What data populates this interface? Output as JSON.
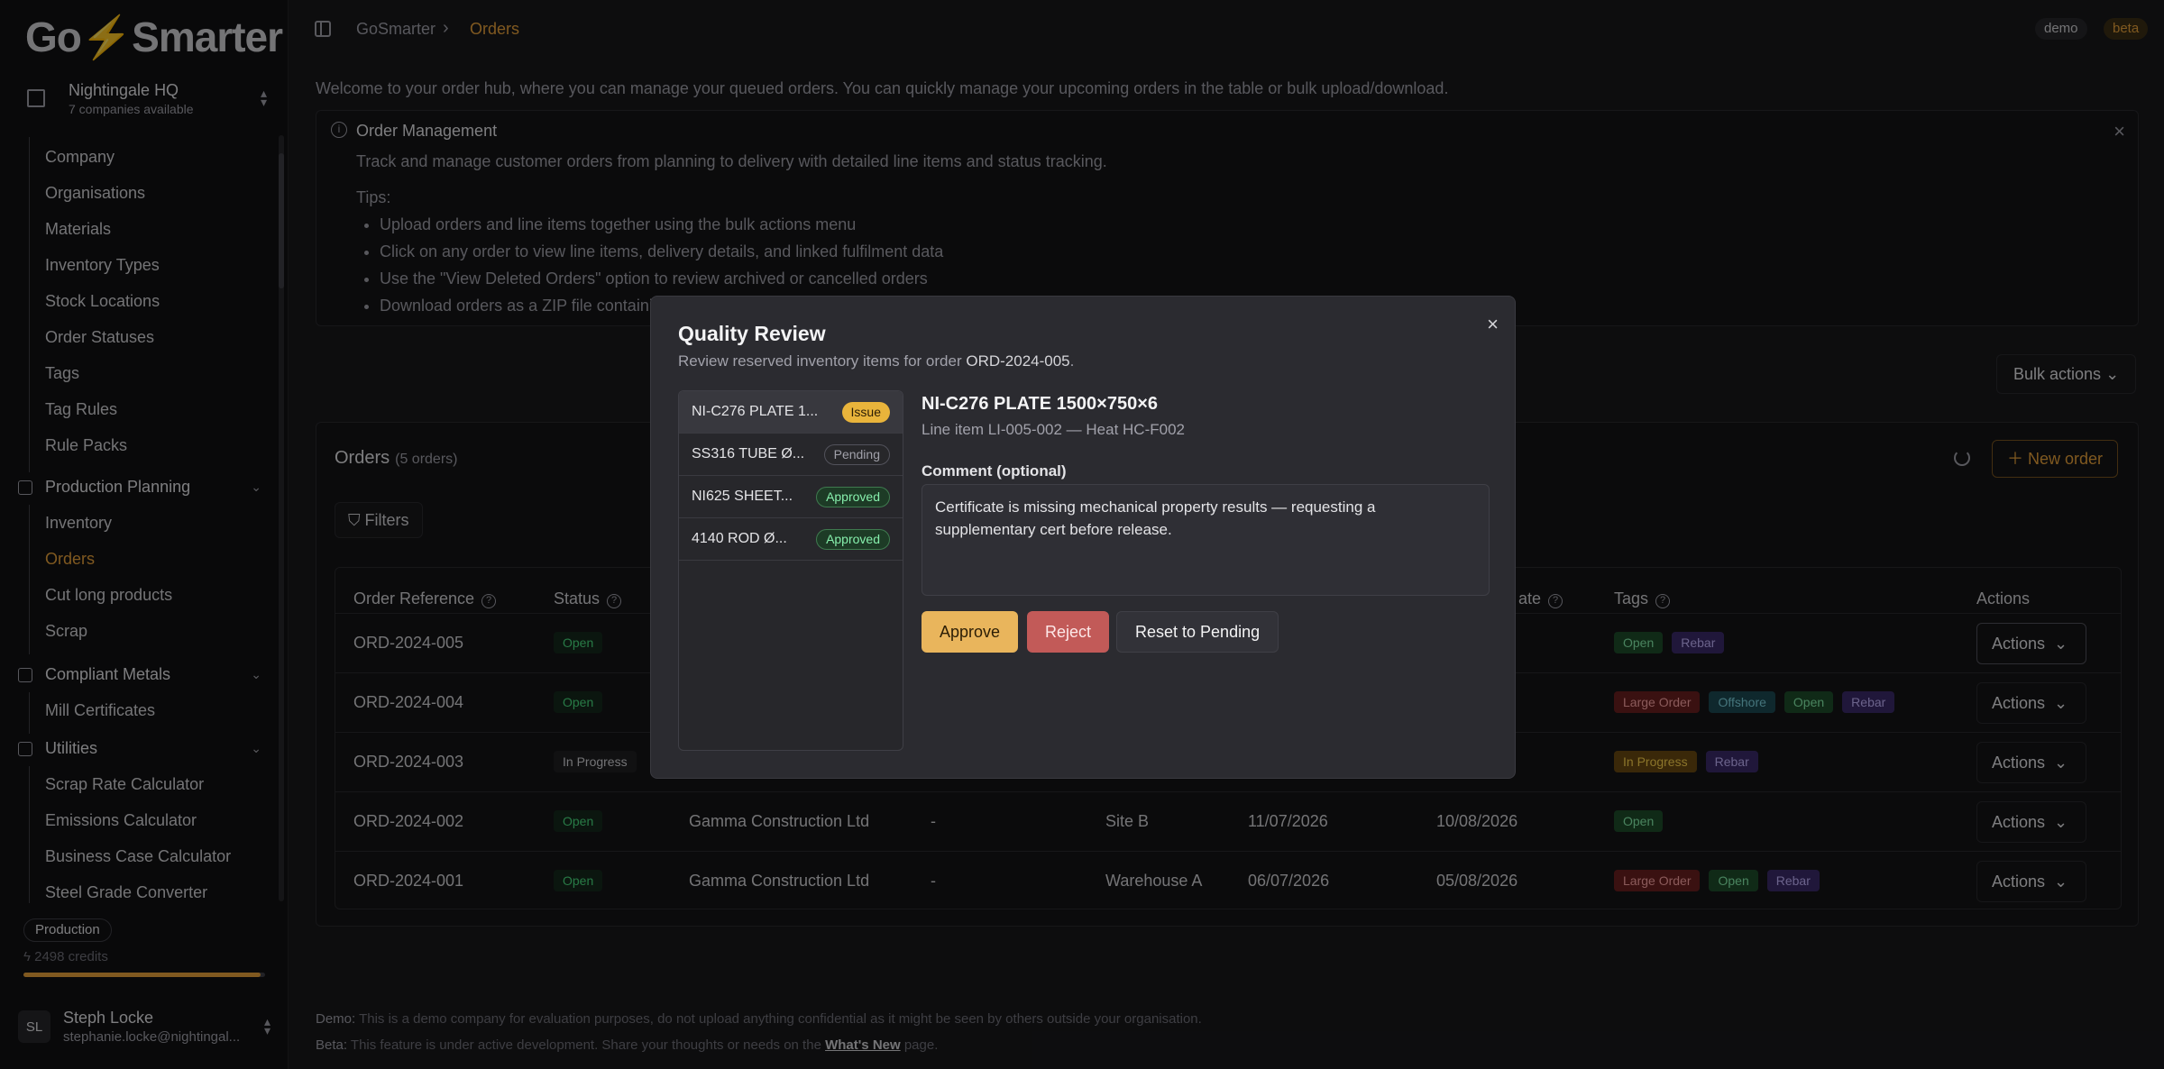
{
  "app": {
    "logo_left": "Go",
    "logo_bolt": "⚡",
    "logo_right": "Smarter"
  },
  "company_switcher": {
    "name": "Nightingale HQ",
    "subtitle": "7 companies available"
  },
  "sidebar": {
    "settings_items": [
      "Company",
      "Organisations",
      "Materials",
      "Inventory Types",
      "Stock Locations",
      "Order Statuses",
      "Tags",
      "Tag Rules",
      "Rule Packs"
    ],
    "production_planning": {
      "label": "Production Planning",
      "items": [
        "Inventory",
        "Orders",
        "Cut long products",
        "Scrap"
      ]
    },
    "compliant_metals": {
      "label": "Compliant Metals",
      "items": [
        "Mill Certificates"
      ]
    },
    "utilities": {
      "label": "Utilities",
      "items": [
        "Scrap Rate Calculator",
        "Emissions Calculator",
        "Business Case Calculator",
        "Steel Grade Converter"
      ]
    },
    "plan_badge": "Production",
    "credits": "2498 credits",
    "credits_fill": 0.98,
    "active_item": "Orders"
  },
  "user": {
    "initials": "SL",
    "name": "Steph Locke",
    "email": "stephanie.locke@nightingal..."
  },
  "header": {
    "breadcrumb_root": "GoSmarter",
    "breadcrumb_current": "Orders",
    "demo_badge": "demo",
    "beta_badge": "beta"
  },
  "welcome": "Welcome to your order hub, where you can manage your queued orders. You can quickly manage your upcoming orders in the table or bulk upload/download.",
  "info_panel": {
    "title": "Order Management",
    "description": "Track and manage customer orders from planning to delivery with detailed line items and status tracking.",
    "tips_heading": "Tips:",
    "tips": [
      "Upload orders and line items together using the bulk actions menu",
      "Click on any order to view line items, delivery details, and linked fulfilment data",
      "Use the \"View Deleted Orders\" option to review archived or cancelled orders",
      "Download orders as a ZIP file containi"
    ]
  },
  "bulk_actions_label": "Bulk actions",
  "orders": {
    "title": "Orders",
    "count": "(5 orders)",
    "new_order_label": "New order",
    "filters_label": "Filters",
    "columns": [
      "Order Reference",
      "Status",
      "",
      "",
      "",
      "",
      "ate",
      "Tags",
      "Actions"
    ],
    "rows": [
      {
        "ref": "ORD-2024-005",
        "status": "Open",
        "customer": "",
        "po": "",
        "location": "",
        "date1": "",
        "date2": "",
        "tags": [
          {
            "t": "Open",
            "c": "green"
          },
          {
            "t": "Rebar",
            "c": "purple"
          }
        ],
        "action": "Actions"
      },
      {
        "ref": "ORD-2024-004",
        "status": "Open",
        "customer": "",
        "po": "",
        "location": "",
        "date1": "",
        "date2": "",
        "tags": [
          {
            "t": "Large Order",
            "c": "red"
          },
          {
            "t": "Offshore",
            "c": "teal"
          },
          {
            "t": "Open",
            "c": "green"
          },
          {
            "t": "Rebar",
            "c": "purple"
          }
        ],
        "action": "Actions"
      },
      {
        "ref": "ORD-2024-003",
        "status": "In Progress",
        "customer": "",
        "po": "",
        "location": "",
        "date1": "",
        "date2": "",
        "tags": [
          {
            "t": "In Progress",
            "c": "amber"
          },
          {
            "t": "Rebar",
            "c": "purple"
          }
        ],
        "action": "Actions"
      },
      {
        "ref": "ORD-2024-002",
        "status": "Open",
        "customer": "Gamma Construction Ltd",
        "po": "-",
        "location": "Site B",
        "date1": "11/07/2026",
        "date2": "10/08/2026",
        "tags": [
          {
            "t": "Open",
            "c": "green"
          }
        ],
        "action": "Actions"
      },
      {
        "ref": "ORD-2024-001",
        "status": "Open",
        "customer": "Gamma Construction Ltd",
        "po": "-",
        "location": "Warehouse A",
        "date1": "06/07/2026",
        "date2": "05/08/2026",
        "tags": [
          {
            "t": "Large Order",
            "c": "red"
          },
          {
            "t": "Open",
            "c": "green"
          },
          {
            "t": "Rebar",
            "c": "purple"
          }
        ],
        "action": "Actions"
      }
    ]
  },
  "footer": {
    "demo_label": "Demo:",
    "demo_text": " This is a demo company for evaluation purposes, do not upload anything confidential as it might be seen by others outside your organisation.",
    "beta_label": "Beta:",
    "beta_text": " This feature is under active development. Share your thoughts or needs on the ",
    "beta_link": "What's New",
    "beta_tail": " page."
  },
  "modal": {
    "title": "Quality Review",
    "subtitle_prefix": "Review reserved inventory items for order ",
    "order_ref": "ORD-2024-005",
    "subtitle_suffix": ".",
    "items": [
      {
        "label": "NI-C276 PLATE 1...",
        "badge": "Issue",
        "kind": "issue"
      },
      {
        "label": "SS316 TUBE Ø...",
        "badge": "Pending",
        "kind": "pending"
      },
      {
        "label": "NI625 SHEET...",
        "badge": "Approved",
        "kind": "approved"
      },
      {
        "label": "4140 ROD Ø...",
        "badge": "Approved",
        "kind": "approved"
      }
    ],
    "detail_title": "NI-C276 PLATE 1500×750×6",
    "detail_sub": "Line item LI-005-002 — Heat HC-F002",
    "comment_label": "Comment (optional)",
    "comment_value": "Certificate is missing mechanical property results — requesting a supplementary cert before release.",
    "approve_label": "Approve",
    "reject_label": "Reject",
    "reset_label": "Reset to Pending"
  },
  "tag_colors": {
    "green": {
      "bg": "#1e4d2b",
      "fg": "#86efac"
    },
    "purple": {
      "bg": "#3b2a6b",
      "fg": "#c4b5fd"
    },
    "red": {
      "bg": "#6b1f1f",
      "fg": "#fca5a5"
    },
    "teal": {
      "bg": "#1d4a52",
      "fg": "#7dd3e0"
    },
    "amber": {
      "bg": "#6b4a12",
      "fg": "#fcd34d"
    }
  }
}
